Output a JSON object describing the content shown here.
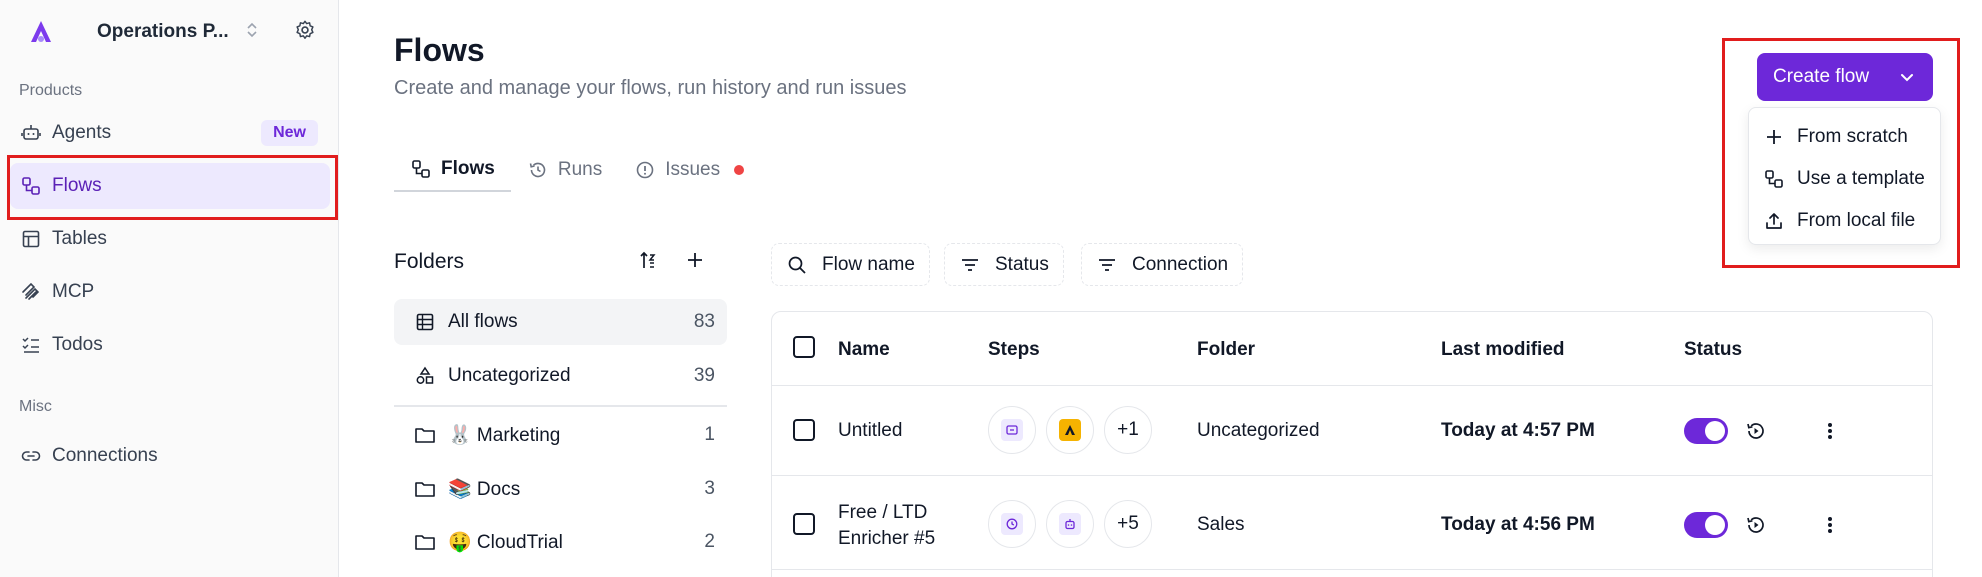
{
  "sidebar": {
    "project_name": "Operations P...",
    "sections": {
      "products": "Products",
      "misc": "Misc"
    },
    "items": [
      {
        "label": "Agents",
        "icon": "bot-icon",
        "badge": "New"
      },
      {
        "label": "Flows",
        "icon": "flow-icon",
        "active": true
      },
      {
        "label": "Tables",
        "icon": "table-icon"
      },
      {
        "label": "MCP",
        "icon": "mcp-icon"
      },
      {
        "label": "Todos",
        "icon": "todo-list-icon"
      },
      {
        "label": "Connections",
        "icon": "link-icon"
      }
    ]
  },
  "header": {
    "title": "Flows",
    "subtitle": "Create and manage your flows, run history and run issues"
  },
  "create_flow": {
    "label": "Create flow",
    "menu": [
      {
        "label": "From scratch",
        "icon": "plus-icon"
      },
      {
        "label": "Use a template",
        "icon": "flow-icon"
      },
      {
        "label": "From local file",
        "icon": "upload-icon"
      }
    ]
  },
  "tabs": [
    {
      "label": "Flows",
      "icon": "flow-icon",
      "active": true
    },
    {
      "label": "Runs",
      "icon": "history-icon"
    },
    {
      "label": "Issues",
      "icon": "alert-circle-icon",
      "has_dot": true
    }
  ],
  "folders": {
    "title": "Folders",
    "items": [
      {
        "label": "All flows",
        "count": "83",
        "icon": "table-icon",
        "active": true
      },
      {
        "label": "Uncategorized",
        "count": "39",
        "icon": "shapes-icon"
      },
      {
        "label": "🐰 Marketing",
        "count": "1",
        "icon": "folder-icon"
      },
      {
        "label": "📚 Docs",
        "count": "3",
        "icon": "folder-icon"
      },
      {
        "label": "🤑 CloudTrial",
        "count": "2",
        "icon": "folder-icon"
      }
    ]
  },
  "filters": [
    {
      "label": "Flow name",
      "icon": "search-icon"
    },
    {
      "label": "Status",
      "icon": "filter-icon"
    },
    {
      "label": "Connection",
      "icon": "filter-icon"
    }
  ],
  "table": {
    "columns": [
      "Name",
      "Steps",
      "Folder",
      "Last modified",
      "Status"
    ],
    "rows": [
      {
        "name_line1": "Untitled",
        "name_line2": "",
        "steps_more": "+1",
        "folder": "Uncategorized",
        "last_modified": "Today at 4:57 PM",
        "enabled": true
      },
      {
        "name_line1": "Free / LTD",
        "name_line2": "Enricher #5",
        "steps_more": "+5",
        "folder": "Sales",
        "last_modified": "Today at 4:56 PM",
        "enabled": true
      }
    ]
  },
  "colors": {
    "accent": "#6d28d9",
    "highlight": "#e11d1d",
    "issue_dot": "#ef4444"
  }
}
